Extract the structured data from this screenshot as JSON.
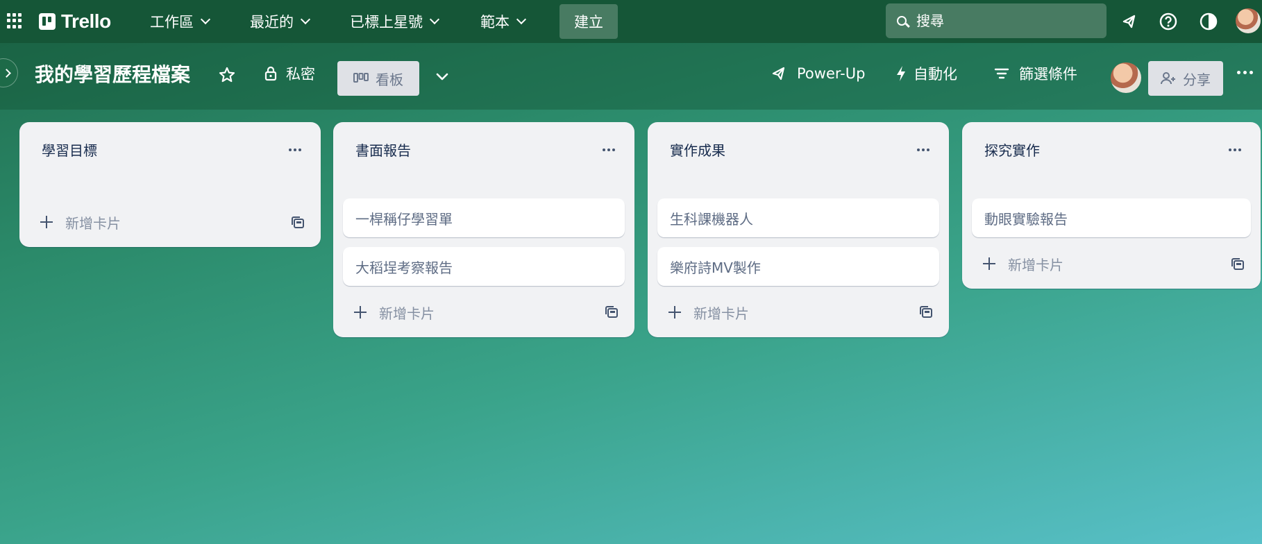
{
  "topnav": {
    "logo_text": "Trello",
    "menus": [
      {
        "label": "工作區"
      },
      {
        "label": "最近的"
      },
      {
        "label": "已標上星號"
      },
      {
        "label": "範本"
      }
    ],
    "create_label": "建立",
    "search_placeholder": "搜尋",
    "icons": [
      "apps-grid-icon",
      "megaphone-icon",
      "help-icon",
      "theme-contrast-icon",
      "user-avatar"
    ]
  },
  "board": {
    "title": "我的學習歷程檔案",
    "visibility_label": "私密",
    "view_label": "看板",
    "powerup_label": "Power-Up",
    "automation_label": "自動化",
    "filter_label": "篩選條件",
    "share_label": "分享"
  },
  "lists": [
    {
      "title": "學習目標",
      "cards": [],
      "add_card_label": "新增卡片"
    },
    {
      "title": "書面報告",
      "cards": [
        "一桿稱仔學習單",
        "大稻埕考察報告"
      ],
      "add_card_label": "新增卡片"
    },
    {
      "title": "實作成果",
      "cards": [
        "生科課機器人",
        "樂府詩MV製作"
      ],
      "add_card_label": "新增卡片"
    },
    {
      "title": "探究實作",
      "cards": [
        "動眼實驗報告"
      ],
      "add_card_label": "新增卡片"
    }
  ],
  "colors": {
    "topnav_bg": "#155637",
    "list_bg": "#f1f2f4",
    "card_bg": "#ffffff",
    "background_gradient": [
      "#1f6b4c",
      "#58c0c8"
    ]
  }
}
